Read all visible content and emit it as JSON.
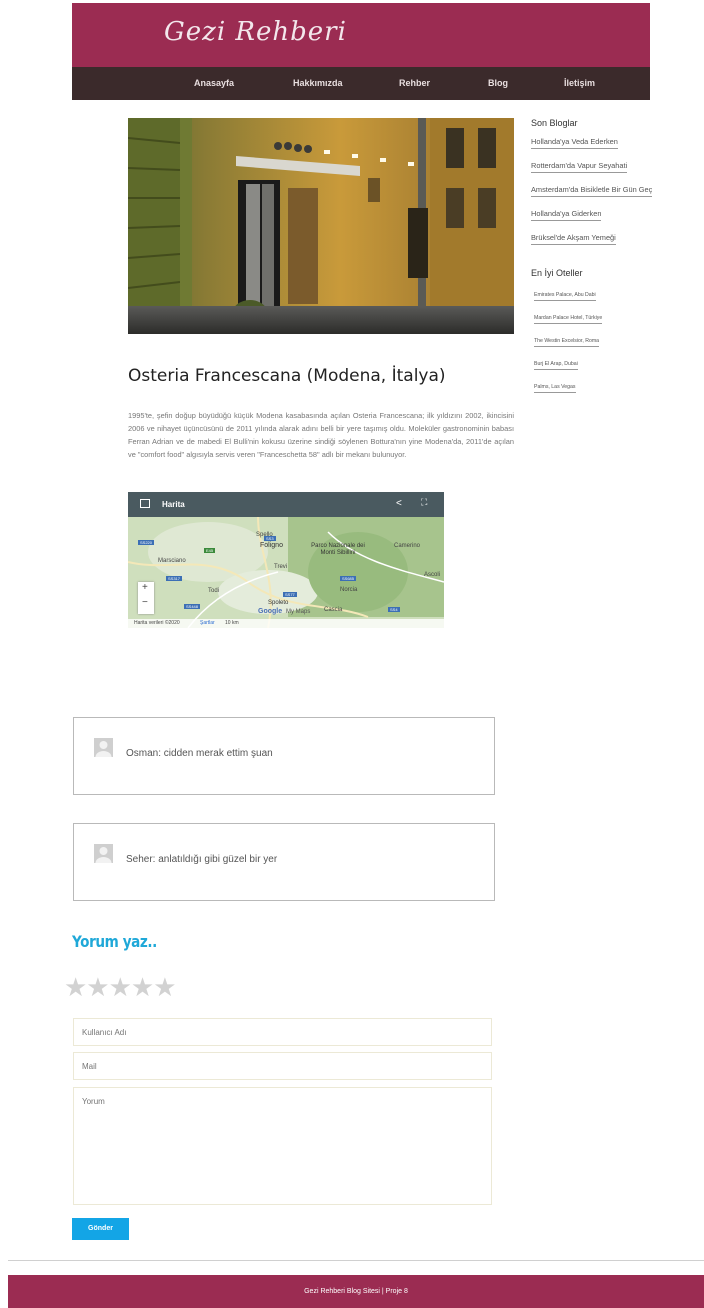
{
  "header": {
    "brand": "Gezi Rehberi"
  },
  "nav": {
    "items": [
      "Anasayfa",
      "Hakkımızda",
      "Rehber",
      "Blog",
      "İletişim"
    ]
  },
  "post": {
    "title": "Osteria Francescana (Modena, İtalya)",
    "body": "1995'te, şefin doğup büyüdüğü küçük Modena kasabasında açılan Osteria Francescana; ilk yıldızını 2002, ikincisini 2006 ve nihayet üçüncüsünü de 2011 yılında alarak adını belli bir yere taşımış oldu. Moleküler gastronominin babası Ferran Adrian ve de mabedi El Bulli'nin kokusu üzerine sindiği söylenen Bottura'nın yine Modena'da, 2011'de açılan ve \"comfort food\" algısıyla servis veren \"Franceschetta 58\" adlı bir mekanı bulunuyor."
  },
  "map": {
    "title": "Harita",
    "places": [
      "Spello",
      "Foligno",
      "Marsciano",
      "Trevi",
      "Parco Nazionale dei Monti Sibillini",
      "Camerino",
      "Todi",
      "Spoleto",
      "Norcia",
      "Cascia",
      "Ascoli"
    ],
    "roads": [
      "SS220",
      "E45",
      "SS317",
      "SS3",
      "SS77",
      "SS685",
      "SS4",
      "SS448"
    ],
    "zoom_in": "+",
    "zoom_out": "−",
    "google": "Google",
    "mymaps": "My Maps",
    "attribution": "Harita verileri ©2020",
    "terms": "Şartlar",
    "scale": "10 km"
  },
  "sidebar": {
    "blogs_title": "Son Bloglar",
    "blogs": [
      "Hollanda'ya Veda Ederken",
      "Rotterdam'da Vapur Seyahati",
      "Amsterdam'da Bisikletle Bir Gün Geçirmek",
      "Hollanda'ya Giderken",
      "Brüksel'de Akşam Yemeği"
    ],
    "hotels_title": "En İyi Oteller",
    "hotels": [
      "Emirates Palace, Abu Dabi",
      "Mardan Palace Hotel, Türkiye",
      "The Westin Excelsior, Roma",
      "Burj El Arap, Dubai",
      "Palms, Las Vegas"
    ]
  },
  "comments": [
    {
      "text": "Osman: cidden merak ettim şuan"
    },
    {
      "text": "Seher: anlatıldığı gibi güzel bir yer"
    }
  ],
  "form": {
    "title": "Yorum yaz..",
    "stars": "★★★★★",
    "username_placeholder": "Kullanıcı Adı",
    "mail_placeholder": "Mail",
    "comment_placeholder": "Yorum",
    "submit": "Gönder"
  },
  "footer": {
    "text": "Gezi Rehberi Blog Sitesi | Proje 8"
  },
  "colors": {
    "brand": "#9b2c52",
    "nav": "#3b2a2b",
    "accent": "#1fa8d8",
    "button": "#13a5e6"
  }
}
